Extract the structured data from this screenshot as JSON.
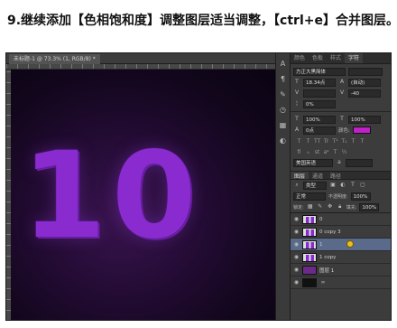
{
  "caption": "9.继续添加【色相饱和度】调整图层适当调整，【ctrl+e】合并图层。",
  "document": {
    "tab_label": "未标题-1 @ 73.3% (1, RGB/8) *",
    "canvas_text": "10"
  },
  "toolstrip": {
    "icons": [
      "type-icon",
      "paragraph-icon",
      "brush-icon",
      "history-icon",
      "swatches-icon",
      "adjust-icon"
    ]
  },
  "character_panel": {
    "tabs": [
      "颜色",
      "色板",
      "样式",
      "字符"
    ],
    "active_tab": "字符",
    "font_family": "方正大黑简体",
    "font_size": "18.34点",
    "leading": "(自动)",
    "kerning": "",
    "tracking": "-40",
    "vertical_scale": "0%",
    "horizontal_scale": "100%",
    "scale_right": "100%",
    "baseline": "0点",
    "color_label": "颜色:",
    "color_value": "#c020c8",
    "style_buttons": [
      "T",
      "T",
      "TT",
      "Tr",
      "T¹",
      "T₁",
      "T",
      "T"
    ],
    "language": "美国英语",
    "antialias": "a"
  },
  "layers_panel": {
    "tabs": [
      "图层",
      "通道",
      "路径"
    ],
    "active_tab": "图层",
    "filter_label": "类型",
    "blend_mode": "正常",
    "opacity_label": "不透明度:",
    "opacity_value": "100%",
    "lock_label": "锁定:",
    "fill_label": "填充:",
    "fill_value": "100%",
    "layers": [
      {
        "name": "0",
        "selected": false,
        "dark": false
      },
      {
        "name": "0 copy 3",
        "selected": false,
        "dark": false
      },
      {
        "name": "1",
        "selected": true,
        "dark": false
      },
      {
        "name": "1 copy",
        "selected": false,
        "dark": false
      },
      {
        "name": "图层 1",
        "selected": false,
        "dark": false
      },
      {
        "name": "",
        "selected": false,
        "dark": true
      }
    ]
  }
}
